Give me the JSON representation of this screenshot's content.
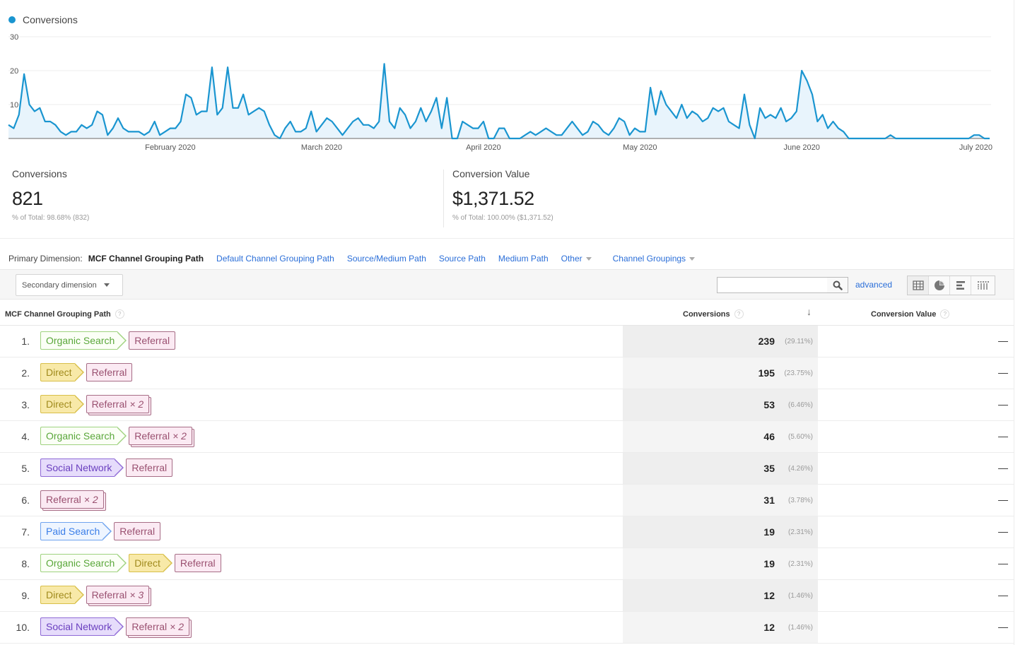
{
  "chart": {
    "legend_label": "Conversions",
    "series_color": "#1a95d0",
    "fill_color": "#e8f4fc"
  },
  "chart_data": {
    "type": "area",
    "title": "",
    "xlabel": "",
    "ylabel": "",
    "ylim": [
      0,
      30
    ],
    "yticks": [
      "30",
      "20",
      "10"
    ],
    "grid": true,
    "legend": "top-left",
    "xtick_labels": [
      "February 2020",
      "March 2020",
      "April 2020",
      "May 2020",
      "June 2020",
      "July 2020"
    ],
    "xtick_day_index": [
      31,
      60,
      91,
      121,
      152,
      182
    ],
    "series": [
      {
        "name": "Conversions",
        "start_date": "2020-01-01",
        "interval": "day",
        "values": [
          4,
          3,
          7,
          19,
          10,
          8,
          9,
          5,
          5,
          4,
          2,
          1,
          2,
          2,
          4,
          3,
          4,
          8,
          7,
          1,
          3,
          6,
          3,
          2,
          2,
          2,
          1,
          2,
          5,
          1,
          2,
          3,
          3,
          5,
          13,
          12,
          7,
          8,
          8,
          21,
          7,
          9,
          21,
          9,
          9,
          13,
          7,
          8,
          9,
          8,
          4,
          1,
          0,
          3,
          5,
          2,
          2,
          3,
          8,
          2,
          4,
          6,
          5,
          3,
          1,
          3,
          5,
          6,
          4,
          4,
          3,
          5,
          22,
          5,
          3,
          9,
          7,
          3,
          5,
          9,
          5,
          8,
          12,
          3,
          12,
          0,
          0,
          5,
          4,
          3,
          3,
          5,
          0,
          0,
          3,
          3,
          0,
          0,
          0,
          1,
          2,
          1,
          2,
          3,
          2,
          1,
          1,
          3,
          5,
          3,
          1,
          2,
          5,
          4,
          2,
          1,
          3,
          6,
          5,
          1,
          3,
          2,
          2,
          15,
          7,
          14,
          10,
          8,
          6,
          10,
          6,
          8,
          7,
          5,
          6,
          9,
          8,
          9,
          5,
          4,
          3,
          13,
          4,
          0,
          9,
          6,
          7,
          6,
          9,
          5,
          6,
          8,
          20,
          17,
          13,
          5,
          7,
          3,
          5,
          3,
          2,
          0,
          0,
          0,
          0,
          0,
          0,
          0,
          0,
          1,
          0,
          0,
          0,
          0,
          0,
          0,
          0,
          0,
          0,
          0,
          0,
          0,
          0,
          0,
          0,
          1,
          1,
          0,
          0
        ]
      }
    ]
  },
  "summary": {
    "conversions": {
      "label": "Conversions",
      "value": "821",
      "sub": "% of Total: 98.68% (832)"
    },
    "conversion_value": {
      "label": "Conversion Value",
      "value": "$1,371.52",
      "sub": "% of Total: 100.00% ($1,371.52)"
    }
  },
  "primary_dimension": {
    "label": "Primary Dimension:",
    "active": "MCF Channel Grouping Path",
    "links": [
      "Default Channel Grouping Path",
      "Source/Medium Path",
      "Source Path",
      "Medium Path"
    ],
    "other": "Other",
    "channel_groupings": "Channel Groupings"
  },
  "toolbar": {
    "secondary_dimension": "Secondary dimension",
    "search_value": "",
    "search_placeholder": "",
    "advanced": "advanced"
  },
  "table": {
    "columns": [
      "MCF Channel Grouping Path",
      "Conversions",
      "Conversion Value"
    ],
    "help_glyph": "?",
    "sort_glyph": "↓",
    "channel_colors": {
      "Organic Search": {
        "fg": "#5aa73a",
        "bg": "#fbfff6",
        "bd": "#9fd27f"
      },
      "Direct": {
        "fg": "#a08a1c",
        "bg": "#f8e9a8",
        "bd": "#d8bf4a"
      },
      "Referral": {
        "fg": "#9a5070",
        "bg": "#fbeaf3",
        "bd": "#a76d86"
      },
      "Social Network": {
        "fg": "#6a3fbf",
        "bg": "#e6dcfb",
        "bd": "#8f6ad6"
      },
      "Paid Search": {
        "fg": "#3a7ee8",
        "bg": "#eef5ff",
        "bd": "#6fa3ef"
      }
    },
    "rows": [
      {
        "num": "1.",
        "path": [
          {
            "ch": "Organic Search",
            "n": ""
          },
          {
            "ch": "Referral",
            "n": ""
          }
        ],
        "conversions": "239",
        "pct": "(29.11%)",
        "value": "—"
      },
      {
        "num": "2.",
        "path": [
          {
            "ch": "Direct",
            "n": ""
          },
          {
            "ch": "Referral",
            "n": ""
          }
        ],
        "conversions": "195",
        "pct": "(23.75%)",
        "value": "—"
      },
      {
        "num": "3.",
        "path": [
          {
            "ch": "Direct",
            "n": ""
          },
          {
            "ch": "Referral",
            "n": "× 2"
          }
        ],
        "conversions": "53",
        "pct": "(6.46%)",
        "value": "—"
      },
      {
        "num": "4.",
        "path": [
          {
            "ch": "Organic Search",
            "n": ""
          },
          {
            "ch": "Referral",
            "n": "× 2"
          }
        ],
        "conversions": "46",
        "pct": "(5.60%)",
        "value": "—"
      },
      {
        "num": "5.",
        "path": [
          {
            "ch": "Social Network",
            "n": ""
          },
          {
            "ch": "Referral",
            "n": ""
          }
        ],
        "conversions": "35",
        "pct": "(4.26%)",
        "value": "—"
      },
      {
        "num": "6.",
        "path": [
          {
            "ch": "Referral",
            "n": "× 2"
          }
        ],
        "conversions": "31",
        "pct": "(3.78%)",
        "value": "—"
      },
      {
        "num": "7.",
        "path": [
          {
            "ch": "Paid Search",
            "n": ""
          },
          {
            "ch": "Referral",
            "n": ""
          }
        ],
        "conversions": "19",
        "pct": "(2.31%)",
        "value": "—"
      },
      {
        "num": "8.",
        "path": [
          {
            "ch": "Organic Search",
            "n": ""
          },
          {
            "ch": "Direct",
            "n": ""
          },
          {
            "ch": "Referral",
            "n": ""
          }
        ],
        "conversions": "19",
        "pct": "(2.31%)",
        "value": "—"
      },
      {
        "num": "9.",
        "path": [
          {
            "ch": "Direct",
            "n": ""
          },
          {
            "ch": "Referral",
            "n": "× 3"
          }
        ],
        "conversions": "12",
        "pct": "(1.46%)",
        "value": "—"
      },
      {
        "num": "10.",
        "path": [
          {
            "ch": "Social Network",
            "n": ""
          },
          {
            "ch": "Referral",
            "n": "× 2"
          }
        ],
        "conversions": "12",
        "pct": "(1.46%)",
        "value": "—"
      }
    ]
  }
}
